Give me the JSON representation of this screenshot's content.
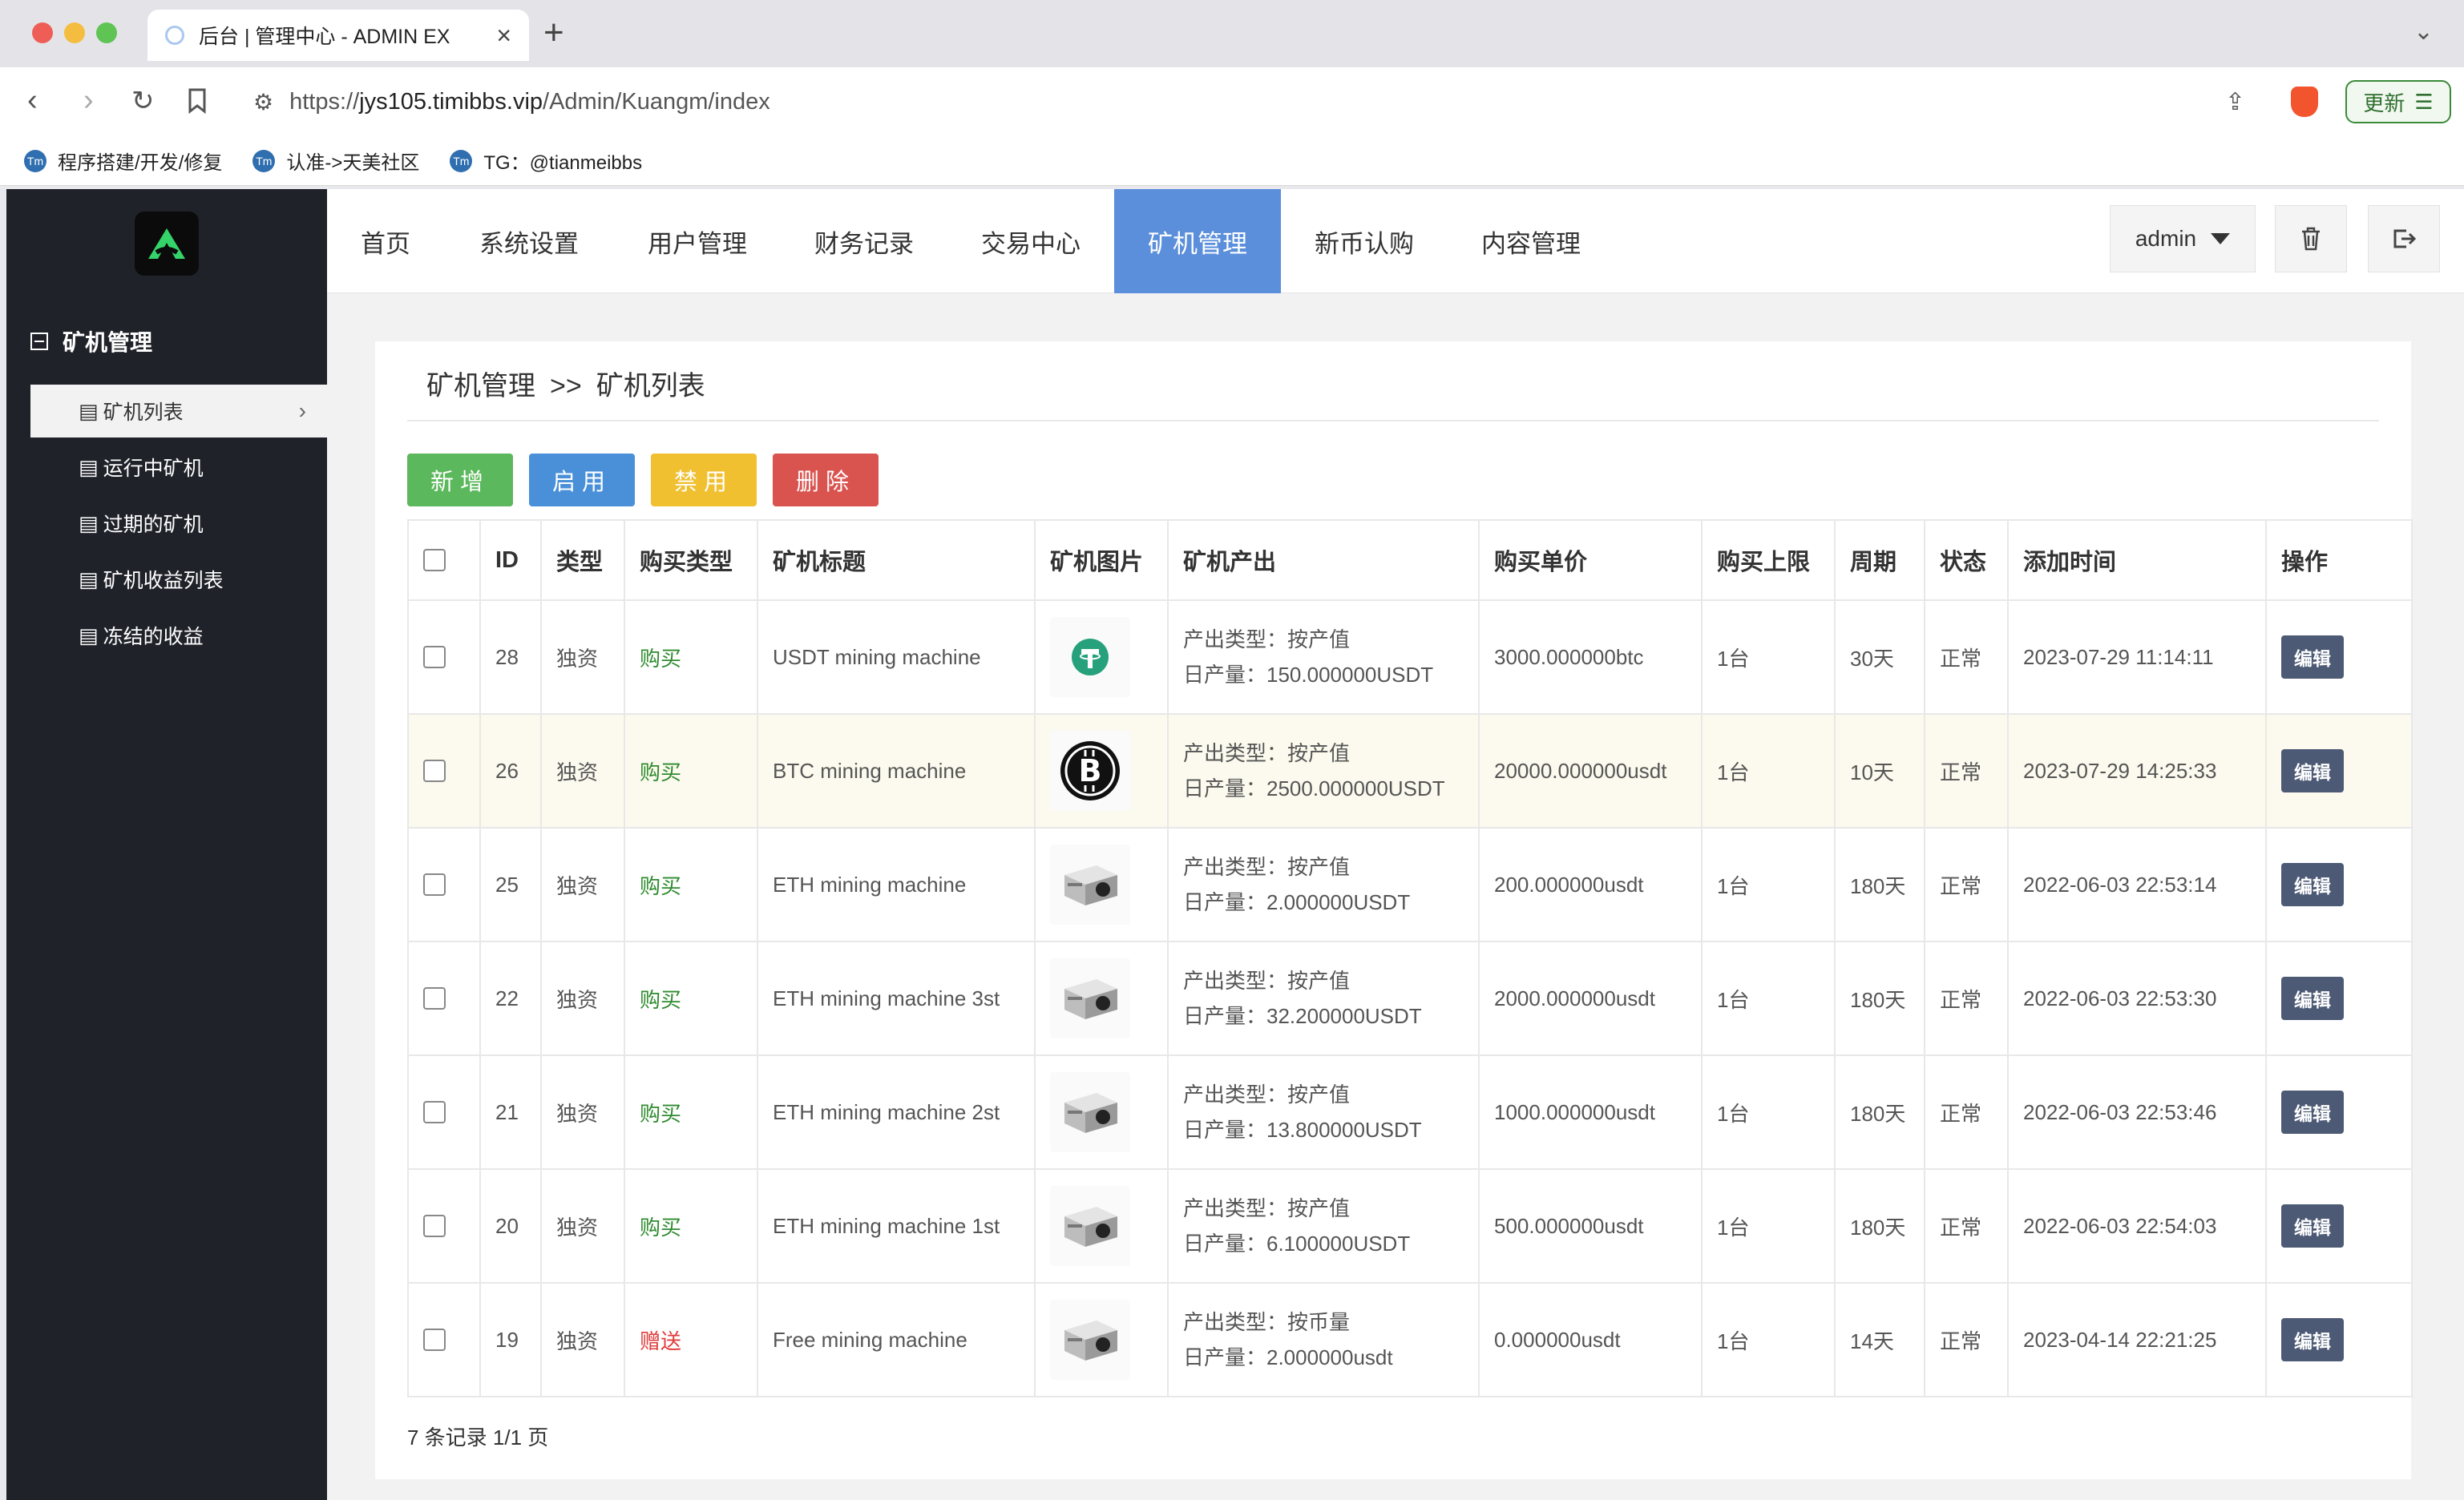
{
  "browser": {
    "tab_title": "后台 | 管理中心 - ADMIN EX",
    "url_prefix": "https://",
    "url_host": "jys105.timibbs.vip",
    "url_path": "/Admin/Kuangm/index",
    "update_label": "更新",
    "bookmarks": [
      {
        "label": "程序搭建/开发/修复"
      },
      {
        "label": "认准->天美社区"
      },
      {
        "label": "TG：@tianmeibbs"
      }
    ]
  },
  "sidebar": {
    "group_title": "矿机管理",
    "items": [
      {
        "label": "矿机列表"
      },
      {
        "label": "运行中矿机"
      },
      {
        "label": "过期的矿机"
      },
      {
        "label": "矿机收益列表"
      },
      {
        "label": "冻结的收益"
      }
    ]
  },
  "topnav": {
    "tabs": [
      {
        "label": "首页"
      },
      {
        "label": "系统设置"
      },
      {
        "label": "用户管理"
      },
      {
        "label": "财务记录"
      },
      {
        "label": "交易中心"
      },
      {
        "label": "矿机管理"
      },
      {
        "label": "新币认购"
      },
      {
        "label": "内容管理"
      }
    ],
    "user": "admin"
  },
  "breadcrumb": {
    "parent": "矿机管理",
    "separator": ">>",
    "current": "矿机列表"
  },
  "actions": {
    "add": "新增",
    "enable": "启用",
    "disable": "禁用",
    "delete": "删除"
  },
  "table": {
    "headers": [
      "ID",
      "类型",
      "购买类型",
      "矿机标题",
      "矿机图片",
      "矿机产出",
      "购买单价",
      "购买上限",
      "周期",
      "状态",
      "添加时间",
      "操作"
    ],
    "rows": [
      {
        "id": "28",
        "type": "独资",
        "buy_type": "购买",
        "title": "USDT mining machine",
        "image": "usdt-coin",
        "output_type": "产出类型：按产值",
        "daily": "日产量：150.000000USDT",
        "price": "3000.000000btc",
        "limit": "1台",
        "period": "30天",
        "status": "正常",
        "time": "2023-07-29 11:14:11",
        "op": "编辑"
      },
      {
        "id": "26",
        "type": "独资",
        "buy_type": "购买",
        "title": "BTC mining machine",
        "image": "btc-coin",
        "output_type": "产出类型：按产值",
        "daily": "日产量：2500.000000USDT",
        "price": "20000.000000usdt",
        "limit": "1台",
        "period": "10天",
        "status": "正常",
        "time": "2023-07-29 14:25:33",
        "op": "编辑"
      },
      {
        "id": "25",
        "type": "独资",
        "buy_type": "购买",
        "title": "ETH mining machine",
        "image": "miner-device",
        "output_type": "产出类型：按产值",
        "daily": "日产量：2.000000USDT",
        "price": "200.000000usdt",
        "limit": "1台",
        "period": "180天",
        "status": "正常",
        "time": "2022-06-03 22:53:14",
        "op": "编辑"
      },
      {
        "id": "22",
        "type": "独资",
        "buy_type": "购买",
        "title": "ETH mining machine 3st",
        "image": "miner-device",
        "output_type": "产出类型：按产值",
        "daily": "日产量：32.200000USDT",
        "price": "2000.000000usdt",
        "limit": "1台",
        "period": "180天",
        "status": "正常",
        "time": "2022-06-03 22:53:30",
        "op": "编辑"
      },
      {
        "id": "21",
        "type": "独资",
        "buy_type": "购买",
        "title": "ETH mining machine 2st",
        "image": "miner-device",
        "output_type": "产出类型：按产值",
        "daily": "日产量：13.800000USDT",
        "price": "1000.000000usdt",
        "limit": "1台",
        "period": "180天",
        "status": "正常",
        "time": "2022-06-03 22:53:46",
        "op": "编辑"
      },
      {
        "id": "20",
        "type": "独资",
        "buy_type": "购买",
        "title": "ETH mining machine 1st",
        "image": "miner-device",
        "output_type": "产出类型：按产值",
        "daily": "日产量：6.100000USDT",
        "price": "500.000000usdt",
        "limit": "1台",
        "period": "180天",
        "status": "正常",
        "time": "2022-06-03 22:54:03",
        "op": "编辑"
      },
      {
        "id": "19",
        "type": "独资",
        "buy_type": "赠送",
        "title": "Free mining machine",
        "image": "miner-device",
        "output_type": "产出类型：按币量",
        "daily": "日产量：2.000000usdt",
        "price": "0.000000usdt",
        "limit": "1台",
        "period": "14天",
        "status": "正常",
        "time": "2023-04-14 22:21:25",
        "op": "编辑"
      }
    ]
  },
  "footer": {
    "summary": "7 条记录 1/1 页"
  },
  "colors": {
    "accent": "#5b8fdb",
    "sidebar": "#20222a",
    "buy": "#2e8b2e",
    "gift": "#e03c3c"
  }
}
